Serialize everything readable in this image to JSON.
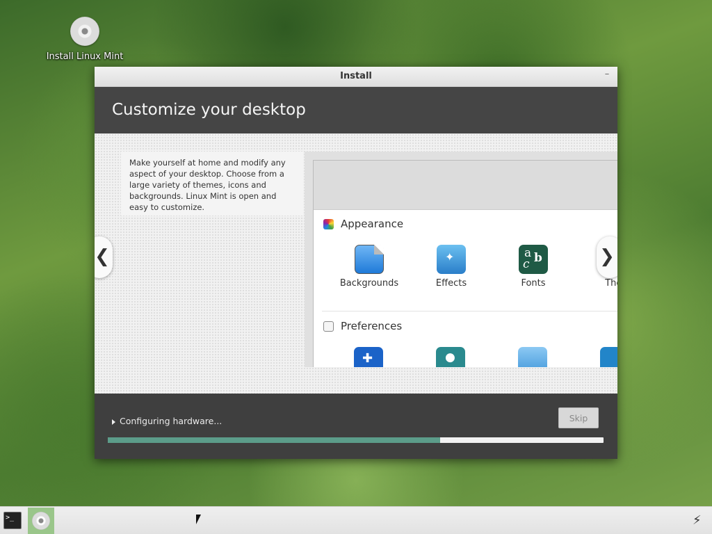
{
  "desktop": {
    "icon_label": "Install Linux Mint"
  },
  "window": {
    "title": "Install",
    "header_title": "Customize your desktop",
    "description": "Make yourself at home and modify any aspect of your desktop. Choose from a large variety of themes, icons and backgrounds. Linux Mint is open and easy to customize.",
    "screenshot": {
      "section_appearance": "Appearance",
      "section_preferences": "Preferences",
      "apps": [
        "Backgrounds",
        "Effects",
        "Fonts",
        "Ther"
      ]
    },
    "nav": {
      "prev": "❮",
      "next": "❯"
    },
    "status": "Configuring hardware...",
    "skip_label": "Skip",
    "progress": 0.67
  },
  "taskbar": {
    "terminal_icon": ">_",
    "network_icon": "⚡"
  }
}
